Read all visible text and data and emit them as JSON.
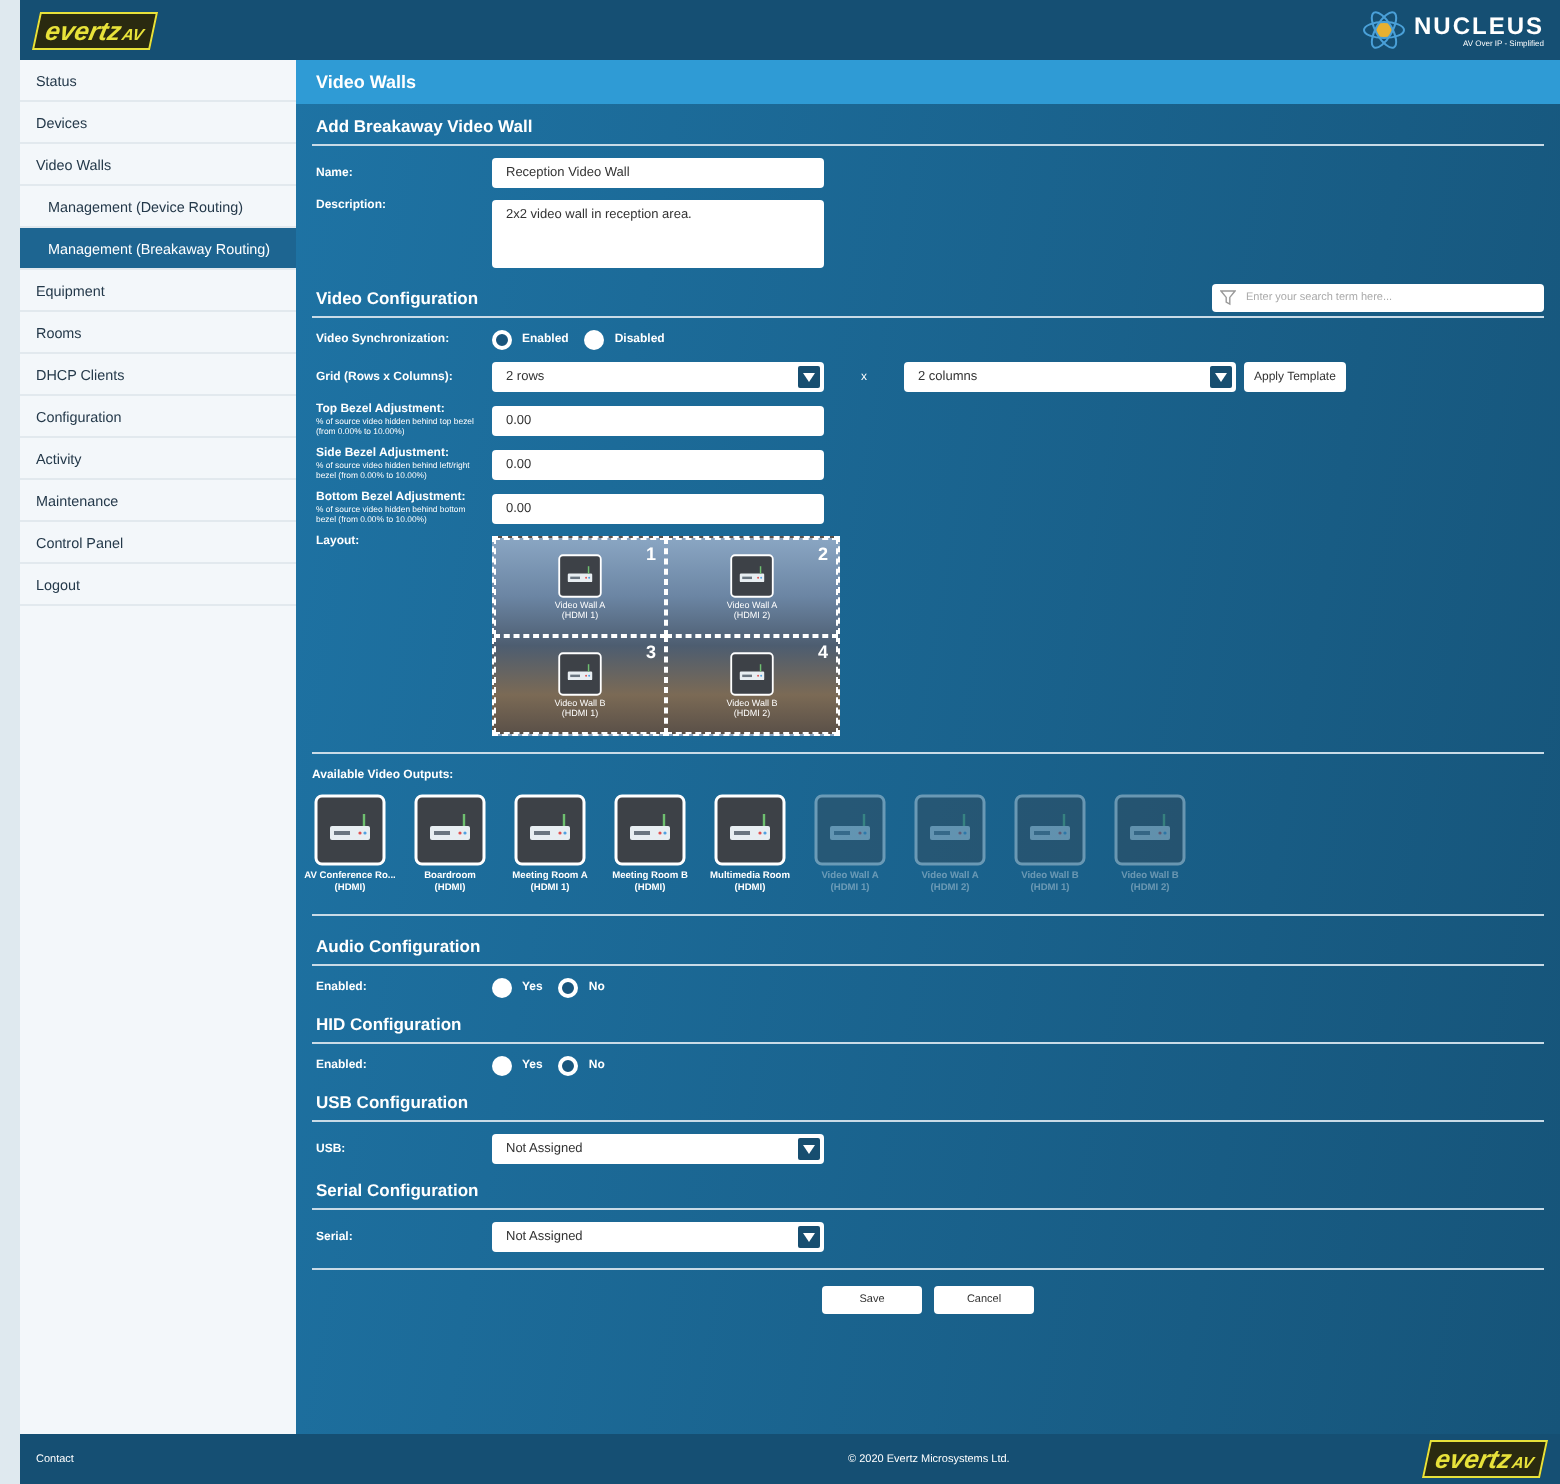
{
  "header": {
    "logo": {
      "brand": "evertz",
      "suffix": "AV"
    },
    "product": {
      "name": "NUCLEUS",
      "tagline": "AV Over IP - Simplified"
    }
  },
  "sidebar": {
    "items": [
      {
        "label": "Status",
        "selected": false
      },
      {
        "label": "Devices",
        "selected": false
      },
      {
        "label": "Video Walls",
        "selected": false,
        "children": [
          {
            "label": "Management (Device Routing)",
            "selected": false
          },
          {
            "label": "Management (Breakaway Routing)",
            "selected": true
          }
        ]
      },
      {
        "label": "Equipment",
        "selected": false
      },
      {
        "label": "Rooms",
        "selected": false
      },
      {
        "label": "DHCP Clients",
        "selected": false
      },
      {
        "label": "Configuration",
        "selected": false
      },
      {
        "label": "Activity",
        "selected": false
      },
      {
        "label": "Maintenance",
        "selected": false
      },
      {
        "label": "Control Panel",
        "selected": false
      },
      {
        "label": "Logout",
        "selected": false
      }
    ]
  },
  "page_title": "Video Walls",
  "form": {
    "heading": "Add Breakaway Video Wall",
    "name": {
      "label": "Name:",
      "value": "Reception Video Wall"
    },
    "description": {
      "label": "Description:",
      "value": "2x2 video wall in reception area."
    }
  },
  "video_configuration": {
    "heading": "Video Configuration",
    "search": {
      "placeholder": "Enter your search term here..."
    },
    "sync": {
      "label": "Video Synchronization:",
      "options": [
        {
          "label": "Enabled",
          "selected": true
        },
        {
          "label": "Disabled",
          "selected": false
        }
      ]
    },
    "grid": {
      "label": "Grid (Rows x Columns):",
      "rows": "2 rows",
      "separator": "x",
      "columns": "2 columns",
      "button": "Apply Template"
    },
    "bezels": [
      {
        "label": "Top Bezel Adjustment:",
        "hint": "% of source video hidden behind top bezel (from 0.00% to 10.00%)",
        "value": "0.00"
      },
      {
        "label": "Side Bezel Adjustment:",
        "hint": "% of source video hidden behind left/right bezel (from 0.00% to 10.00%)",
        "value": "0.00"
      },
      {
        "label": "Bottom Bezel Adjustment:",
        "hint": "% of source video hidden behind bottom bezel (from 0.00% to 10.00%)",
        "value": "0.00"
      }
    ],
    "layout": {
      "label": "Layout:",
      "tiles": [
        {
          "number": "1",
          "name": "Video Wall A",
          "port": "(HDMI 1)"
        },
        {
          "number": "2",
          "name": "Video Wall A",
          "port": "(HDMI 2)"
        },
        {
          "number": "3",
          "name": "Video Wall B",
          "port": "(HDMI 1)"
        },
        {
          "number": "4",
          "name": "Video Wall B",
          "port": "(HDMI 2)"
        }
      ]
    }
  },
  "outputs": {
    "label": "Available Video Outputs:",
    "items": [
      {
        "name": "AV Conference Ro...",
        "port": "(HDMI)",
        "disabled": false
      },
      {
        "name": "Boardroom",
        "port": "(HDMI)",
        "disabled": false
      },
      {
        "name": "Meeting Room A",
        "port": "(HDMI 1)",
        "disabled": false
      },
      {
        "name": "Meeting Room B",
        "port": "(HDMI)",
        "disabled": false
      },
      {
        "name": "Multimedia Room",
        "port": "(HDMI)",
        "disabled": false
      },
      {
        "name": "Video Wall A",
        "port": "(HDMI 1)",
        "disabled": true
      },
      {
        "name": "Video Wall A",
        "port": "(HDMI 2)",
        "disabled": true
      },
      {
        "name": "Video Wall B",
        "port": "(HDMI 1)",
        "disabled": true
      },
      {
        "name": "Video Wall B",
        "port": "(HDMI 2)",
        "disabled": true
      }
    ]
  },
  "sections": [
    {
      "kind": "radio",
      "heading": "Audio Configuration",
      "label": "Enabled:",
      "options": [
        {
          "label": "Yes",
          "selected": false
        },
        {
          "label": "No",
          "selected": true
        }
      ]
    },
    {
      "kind": "radio",
      "heading": "HID Configuration",
      "label": "Enabled:",
      "options": [
        {
          "label": "Yes",
          "selected": false
        },
        {
          "label": "No",
          "selected": true
        }
      ]
    },
    {
      "kind": "select",
      "heading": "USB Configuration",
      "label": "USB:",
      "value": "Not Assigned"
    },
    {
      "kind": "select",
      "heading": "Serial Configuration",
      "label": "Serial:",
      "value": "Not Assigned"
    }
  ],
  "buttons": [
    "Save",
    "Cancel"
  ],
  "footer": {
    "contact": "Contact",
    "copyright": "© 2020 Evertz Microsystems Ltd.",
    "logo": {
      "brand": "evertz",
      "suffix": "AV"
    }
  }
}
